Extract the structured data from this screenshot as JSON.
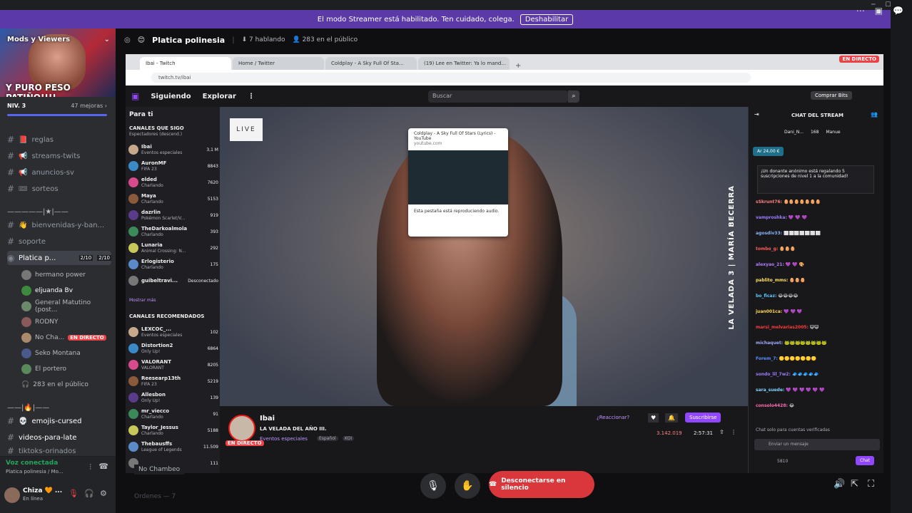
{
  "banner": {
    "text": "El modo Streamer está habilitado. Ten cuidado, colega.",
    "button": "Deshabilitar"
  },
  "guild": {
    "name": "Mods y Viewers",
    "slogan": "Y PURO PESO PATIÑO!!!!",
    "level": "NIV. 3",
    "boosts": "47 mejoras ›"
  },
  "channels": [
    {
      "icon": "📕",
      "name": "reglas"
    },
    {
      "icon": "📢",
      "name": "streams-twits"
    },
    {
      "icon": "📢",
      "name": "anuncios-sv"
    },
    {
      "icon": "🎟",
      "name": "sorteos"
    }
  ],
  "divider1": "—————|★|——",
  "channels2": [
    {
      "icon": "👋",
      "name": "bienvenidas-y-ban..."
    },
    {
      "icon": "",
      "name": "soporte"
    }
  ],
  "active_channel": {
    "name": "Platica p...",
    "c1": "2/10",
    "c2": "2/10"
  },
  "voice_users": [
    {
      "name": "hermano power"
    },
    {
      "name": "eljuanda Bv"
    },
    {
      "name": "General Matutino (post..."
    },
    {
      "name": "RODNY"
    },
    {
      "name": "No Cha...",
      "badge": "EN DIRECTO"
    },
    {
      "name": "Seko Montana"
    },
    {
      "name": "El portero"
    },
    {
      "name": "283 en el público"
    }
  ],
  "divider2": "——|🔥|——",
  "channels3": [
    {
      "icon": "💀",
      "name": "emojis-cursed"
    },
    {
      "icon": "",
      "name": "videos-para-late"
    },
    {
      "icon": "",
      "name": "tiktoks-orinados"
    }
  ],
  "voicebar": {
    "status": "Voz conectada",
    "sub": "Platica polinesia / Mo..."
  },
  "userbar": {
    "name": "Chiza 🧡 ...",
    "status": "En línea"
  },
  "header": {
    "title": "Platica polinesia",
    "speaking": "7 hablando",
    "audience": "283 en el público"
  },
  "browser": {
    "tabs": [
      "Ibai - Twitch",
      "Home / Twitter",
      "Coldplay - A Sky Full Of Sta...",
      "(19) Lee en Twitter: Ya lo mand..."
    ],
    "url": "twitch.tv/ibai",
    "live_badge": "EN DIRECTO"
  },
  "twitch": {
    "nav": [
      "Siguiendo",
      "Explorar",
      "⋮"
    ],
    "search_placeholder": "Buscar",
    "bits_button": "Comprar Bits",
    "for_you": "Para ti",
    "followed_title": "CANALES QUE SIGO",
    "followed_sub": "Espectadores (descend.)",
    "followed": [
      {
        "n": "Ibai",
        "g": "Eventos especiales",
        "v": "3,1 M"
      },
      {
        "n": "AuronMF",
        "g": "FIFA 23",
        "v": "8843"
      },
      {
        "n": "elded",
        "g": "Charlando",
        "v": "7620"
      },
      {
        "n": "Maya",
        "g": "Charlando",
        "v": "5153"
      },
      {
        "n": "dazrlin",
        "g": "Pokémon Scarlet/V...",
        "v": "919"
      },
      {
        "n": "TheDarkoalmola",
        "g": "Charlando",
        "v": "393"
      },
      {
        "n": "Lunaria",
        "g": "Animal Crossing: N...",
        "v": "292"
      },
      {
        "n": "Erlogisterio",
        "g": "Charlando",
        "v": "175"
      },
      {
        "n": "guibeltravi...",
        "g": "",
        "v": "Desconectado"
      }
    ],
    "show_more": "Mostrar más",
    "recommended_title": "CANALES RECOMENDADOS",
    "recommended": [
      {
        "n": "LEXCOC_...",
        "g": "Eventos especiales",
        "v": "102"
      },
      {
        "n": "Distortion2",
        "g": "Only Up!",
        "v": "6864"
      },
      {
        "n": "VALORANT",
        "g": "VALORANT",
        "v": "8205"
      },
      {
        "n": "Reesearp13th",
        "g": "FIFA 23",
        "v": "5219"
      },
      {
        "n": "Allesbon",
        "g": "Only Up!",
        "v": "139"
      },
      {
        "n": "mr_viecco",
        "g": "Charlando",
        "v": "91"
      },
      {
        "n": "Taylor_Jessus",
        "g": "Charlando",
        "v": "5188"
      },
      {
        "n": "Thebausffs",
        "g": "League of Legends",
        "v": "11.509"
      },
      {
        "n": "",
        "g": "",
        "v": "111"
      }
    ],
    "video_live_badge": "LIVE",
    "vertical_label": "LA VELADA 3 | MARÍA BECERRA",
    "popup": {
      "title": "Coldplay - A Sky Full Of Stars (Lyrics) - YouTube",
      "domain": "youtube.com",
      "note": "Esta pestaña está reproduciendo audio."
    },
    "streamer": "Ibai",
    "stream_title": "LA VELADA DEL AÑO III.",
    "category": "Eventos especiales",
    "tags": [
      "Español",
      "KOI"
    ],
    "live": "EN DIRECTO",
    "react": "¿Reaccionar?",
    "subscribe": "Suscribirse",
    "viewers": "3.142.019",
    "uptime": "2:57:31",
    "chat_title": "CHAT DEL STREAM",
    "chat_top": [
      "Dani_N...",
      "168",
      "Manue"
    ],
    "hype": "Ar 24,00 €",
    "gift": "¡Un donante anónimo está regalando 5 suscripciones de nivel 1 a la comunidad!",
    "chat": [
      {
        "u": "sSkrunt76:",
        "m": "🥚🥚🥚🥚🥚🥚🥚",
        "c": "#ff7f7f"
      },
      {
        "u": "vamproshka:",
        "m": "💜 💜 💜",
        "c": "#9d7bff"
      },
      {
        "u": "agosdiv33:",
        "m": "⬜⬜⬜⬜⬜⬜⬜",
        "c": "#8ab4f8"
      },
      {
        "u": "tombo_g:",
        "m": "🥚🥚🥚",
        "c": "#ff5a5a"
      },
      {
        "u": "alexyao_21:",
        "m": "💜 💜 🎨",
        "c": "#b57bff"
      },
      {
        "u": "pablito_mms:",
        "m": "🥚🥚🥚",
        "c": "#ffe05a"
      },
      {
        "u": "bo_ficaz:",
        "m": "😂😂😂😂",
        "c": "#5ac8ff"
      },
      {
        "u": "juan001ca:",
        "m": "💜 💜 💜",
        "c": "#ffd84a"
      },
      {
        "u": "marsi_melvarias2005:",
        "m": "😺😺",
        "c": "#ff3a3a"
      },
      {
        "u": "michaquet:",
        "m": "🐸🐸🐸🐸🐸🐸🐸🐸",
        "c": "#9fa8ff"
      },
      {
        "u": "Forem_7:",
        "m": "🟡🟡🟡🟡🟡🟡🟡",
        "c": "#5a8cff"
      },
      {
        "u": "sondo_lil_7w2:",
        "m": "🧢🧢🧢🧢🧢",
        "c": "#9d7bff"
      },
      {
        "u": "sara_suede:",
        "m": "💜 💜 💜 💜 💜 💜",
        "c": "#7bd5ff"
      },
      {
        "u": "consolo4428:",
        "m": "😂",
        "c": "#ff6ab0"
      }
    ],
    "chat_notice": "Chat solo para cuentas verificadas",
    "chat_placeholder": "Enviar un mensaje",
    "chat_points": "5810",
    "chat_send": "Chat"
  },
  "bottom": {
    "disconnect": "Desconectarse en silencio",
    "bg_label": "No Chambeo",
    "bottom_text": "Ordenes — 7"
  },
  "colors": {
    "accent": "#5b3aa8",
    "twitch": "#9147ff",
    "danger": "#da373c"
  }
}
